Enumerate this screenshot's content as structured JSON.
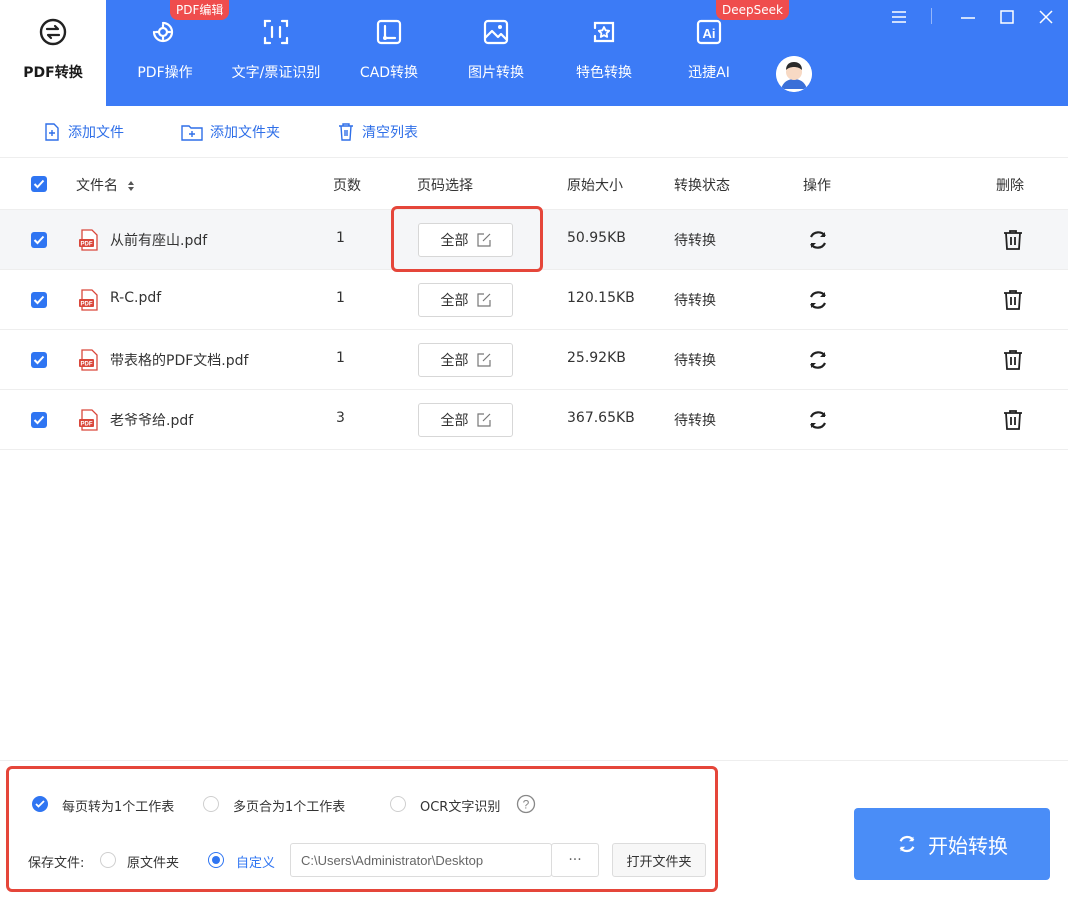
{
  "colors": {
    "brand": "#3c7bf6",
    "accent": "#2f75f2",
    "highlight": "#e5463a",
    "badge": "#ef4d4d",
    "start_button": "#4a8df7"
  },
  "nav": {
    "items": [
      {
        "label": "PDF转换",
        "icon": "swap-arrows-icon",
        "active": true
      },
      {
        "label": "PDF操作",
        "icon": "gear-doc-icon",
        "badge": "PDF编辑"
      },
      {
        "label": "文字/票证识别",
        "icon": "scan-text-icon"
      },
      {
        "label": "CAD转换",
        "icon": "cad-icon"
      },
      {
        "label": "图片转换",
        "icon": "image-icon"
      },
      {
        "label": "特色转换",
        "icon": "star-swap-icon"
      },
      {
        "label": "迅捷AI",
        "icon": "ai-icon",
        "badge": "DeepSeek"
      }
    ],
    "window_controls": [
      "menu-icon",
      "minimize-icon",
      "maximize-icon",
      "close-icon"
    ]
  },
  "toolbar": {
    "add_file": "添加文件",
    "add_folder": "添加文件夹",
    "clear_list": "清空列表"
  },
  "table": {
    "headers": {
      "filename": "文件名",
      "sort_icon": "sort-icon",
      "pages": "页数",
      "page_range": "页码选择",
      "size": "原始大小",
      "status": "转换状态",
      "action": "操作",
      "delete": "删除"
    },
    "rows": [
      {
        "name": "从前有座山.pdf",
        "pages": "1",
        "range": "全部",
        "size": "50.95KB",
        "status": "待转换",
        "checked": true
      },
      {
        "name": "R-C.pdf",
        "pages": "1",
        "range": "全部",
        "size": "120.15KB",
        "status": "待转换",
        "checked": true
      },
      {
        "name": "带表格的PDF文档.pdf",
        "pages": "1",
        "range": "全部",
        "size": "25.92KB",
        "status": "待转换",
        "checked": true
      },
      {
        "name": "老爷爷给.pdf",
        "pages": "3",
        "range": "全部",
        "size": "367.65KB",
        "status": "待转换",
        "checked": true
      }
    ]
  },
  "options": {
    "mode_per_page": "每页转为1个工作表",
    "mode_merge": "多页合为1个工作表",
    "ocr": "OCR文字识别",
    "selected_mode": "每页转为1个工作表"
  },
  "save": {
    "label": "保存文件:",
    "original_folder": "原文件夹",
    "custom": "自定义",
    "selected": "自定义",
    "path": "C:\\Users\\Administrator\\Desktop",
    "browse": "···",
    "open_folder": "打开文件夹"
  },
  "start_button": "开始转换"
}
